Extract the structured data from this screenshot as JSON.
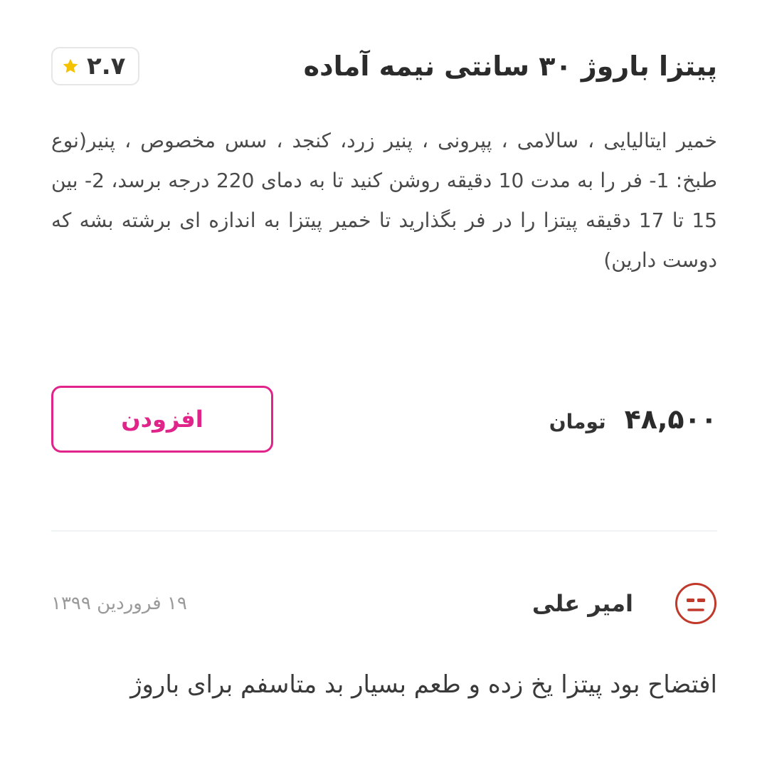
{
  "product": {
    "title": "پیتزا باروژ ۳۰ سانتی نیمه آماده",
    "rating": "۲.۷",
    "rating_icon": "star-icon",
    "description": "خمیر ایتالیایی ، سالامی ، پپرونی ، پنیر زرد، کنجد ، سس مخصوص ، پنیر(نوع طبخ: 1- فر را به مدت 10 دقیقه روشن کنید تا به دمای 220 درجه برسد، 2- بین 15 تا 17 دقیقه پیتزا را در فر بگذارید تا خمیر پیتزا به اندازه ای برشته بشه که دوست دارین)",
    "price": "۴۸,۵۰۰",
    "price_unit": "تومان",
    "add_label": "افزودن"
  },
  "review": {
    "author": "امیر علی",
    "avatar_icon": "unamused-face-icon",
    "date": "۱۹ فروردین ۱۳۹۹",
    "text": "افتضاح بود پیتزا یخ زده و طعم بسیار بد متاسفم برای باروژ"
  },
  "colors": {
    "accent": "#e0248a",
    "star": "#f5c200",
    "avatar": "#c0392b",
    "divider": "#eef3f5"
  }
}
